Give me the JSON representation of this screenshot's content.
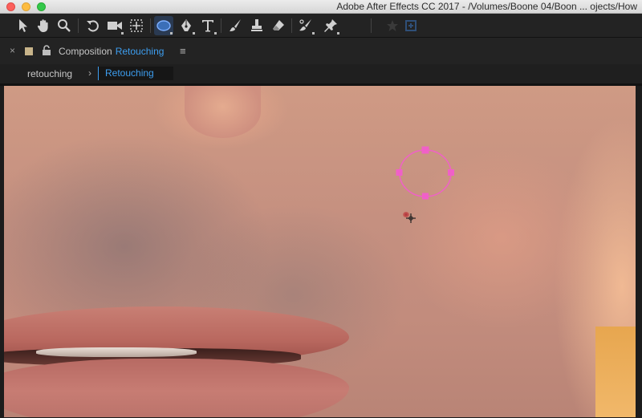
{
  "window": {
    "title": "Adobe After Effects CC 2017 - /Volumes/Boone 04/Boon ... ojects/How"
  },
  "toolbar": {
    "tools": [
      {
        "name": "selection-tool",
        "icon": "arrow-icon"
      },
      {
        "name": "hand-tool",
        "icon": "hand-icon"
      },
      {
        "name": "zoom-tool",
        "icon": "magnifier-icon"
      },
      {
        "name": "rotation-tool",
        "icon": "rotate-icon"
      },
      {
        "name": "camera-tool",
        "icon": "camera-icon"
      },
      {
        "name": "pan-behind-tool",
        "icon": "pan-behind-icon"
      },
      {
        "name": "ellipse-tool",
        "icon": "ellipse-icon",
        "active": true
      },
      {
        "name": "pen-tool",
        "icon": "pen-icon"
      },
      {
        "name": "type-tool",
        "icon": "type-icon",
        "label": "T"
      },
      {
        "name": "brush-tool",
        "icon": "brush-icon"
      },
      {
        "name": "clone-stamp-tool",
        "icon": "stamp-icon"
      },
      {
        "name": "eraser-tool",
        "icon": "eraser-icon"
      },
      {
        "name": "roto-brush-tool",
        "icon": "roto-brush-icon"
      },
      {
        "name": "puppet-pin-tool",
        "icon": "pin-icon"
      },
      {
        "name": "local-axis-mode",
        "icon": "star-icon"
      },
      {
        "name": "snapping-toggle",
        "icon": "snap-icon"
      }
    ]
  },
  "panel": {
    "close_glyph": "×",
    "label": "Composition",
    "comp_name": "Retouching",
    "menu_glyph": "≡"
  },
  "breadcrumb": {
    "parent": "retouching",
    "separator": "›",
    "current": "Retouching"
  },
  "colors": {
    "accent": "#3d9ef0",
    "mask_path": "#f060c8"
  }
}
